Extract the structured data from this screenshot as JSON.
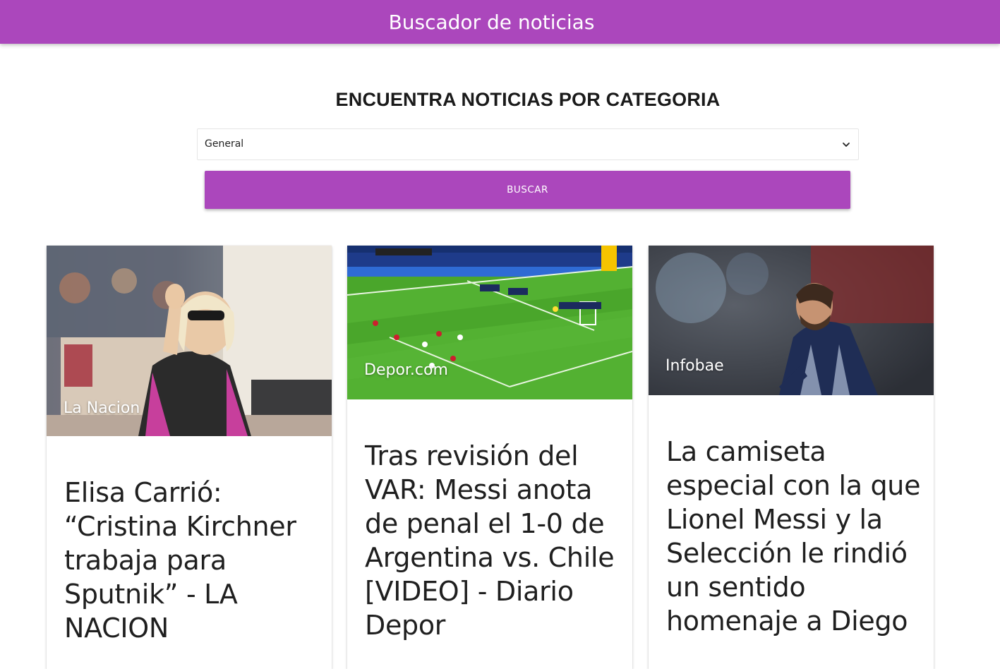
{
  "app": {
    "title": "Buscador de noticias",
    "accent_color": "#ab47bc"
  },
  "search": {
    "heading": "ENCUENTRA NOTICIAS POR CATEGORIA",
    "category_selected": "General",
    "button_label": "BUSCAR"
  },
  "news": [
    {
      "source": "La Nacion",
      "title": "Elisa Carrió: “Cristina Kirchner trabaja para Sputnik” - LA NACION",
      "image": "photo-woman-waving"
    },
    {
      "source": "Depor.com",
      "title": "Tras revisión del VAR: Messi anota de penal el 1-0 de Argentina vs. Chile [VIDEO] - Diario Depor",
      "image": "photo-football-penalty"
    },
    {
      "source": "Infobae",
      "title": "La camiseta especial con la que Lionel Messi y la Selección le rindió un sentido homenaje a Diego",
      "image": "photo-player-jersey"
    }
  ]
}
